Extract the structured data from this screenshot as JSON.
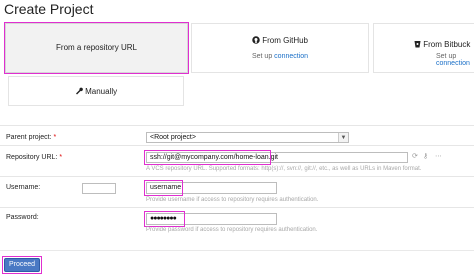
{
  "page": {
    "title": "Create Project"
  },
  "cards": {
    "repository_url": {
      "label": "From a repository URL"
    },
    "github": {
      "label": "From GitHub",
      "setup_prefix": "Set up",
      "setup_link": "connection",
      "icon": "github-icon"
    },
    "bitbucket": {
      "label": "From Bitbuck",
      "setup_prefix": "Set up",
      "setup_link": "connection",
      "icon": "bitbucket-icon"
    },
    "manually": {
      "label": "Manually",
      "icon": "wrench-icon"
    }
  },
  "form": {
    "parent_project": {
      "label": "Parent project:",
      "required": "*",
      "value": "<Root project>"
    },
    "repository_url": {
      "label": "Repository URL:",
      "required": "*",
      "value": "ssh://git@mycompany.com/home-loan.git",
      "hint": "A VCS repository URL. Supported formats: http(s)://, svn://, git://, etc., as well as URLs in Maven format."
    },
    "username": {
      "label": "Username:",
      "value": "username",
      "hint": "Provide username if access to repository requires authentication."
    },
    "password": {
      "label": "Password:",
      "value": "●●●●●●●●",
      "hint": "Provide password if access to repository requires authentication."
    }
  },
  "actions": {
    "proceed_label": "Proceed"
  },
  "colors": {
    "highlight": "#e02fd0",
    "link": "#1a6fc7",
    "primary_button": "#4a79c4"
  }
}
